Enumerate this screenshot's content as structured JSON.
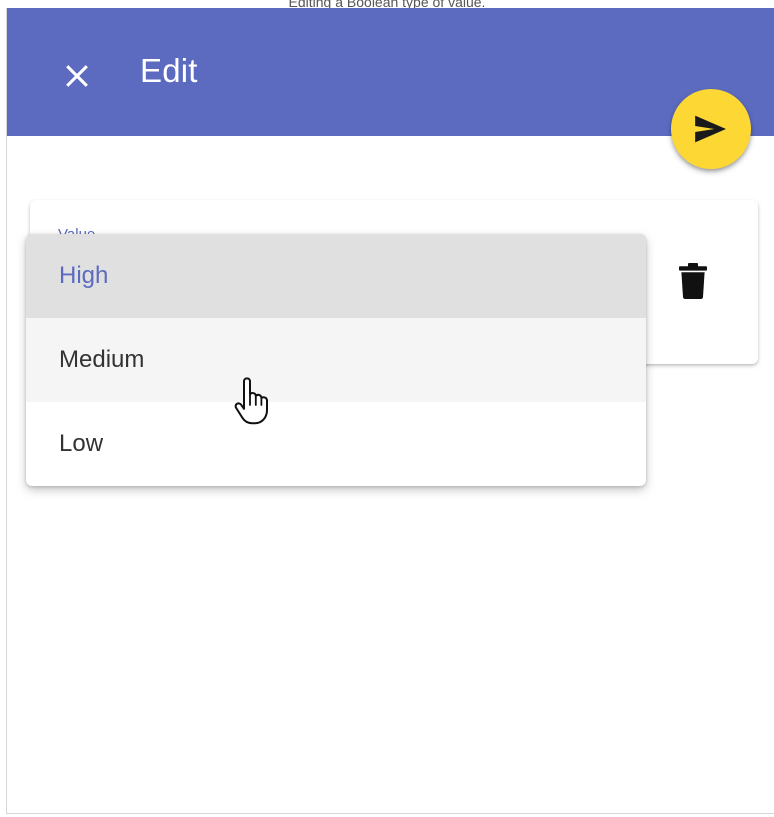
{
  "caption": "Editing a Boolean type of value.",
  "colors": {
    "appbar": "#5c6bc0",
    "fab": "#fdd835",
    "selected_text": "#5c6bc0",
    "selected_bg": "#e0e0e0",
    "hover_bg": "#f5f5f5"
  },
  "appbar": {
    "close_icon": "close-icon",
    "title": "Edit"
  },
  "fab": {
    "icon": "send-icon"
  },
  "field": {
    "label": "Value",
    "delete_icon": "trash-icon"
  },
  "menu": {
    "options": [
      {
        "label": "High",
        "state": "selected"
      },
      {
        "label": "Medium",
        "state": "hover"
      },
      {
        "label": "Low",
        "state": "normal"
      }
    ]
  },
  "pointer": {
    "icon": "hand-pointer-icon"
  }
}
